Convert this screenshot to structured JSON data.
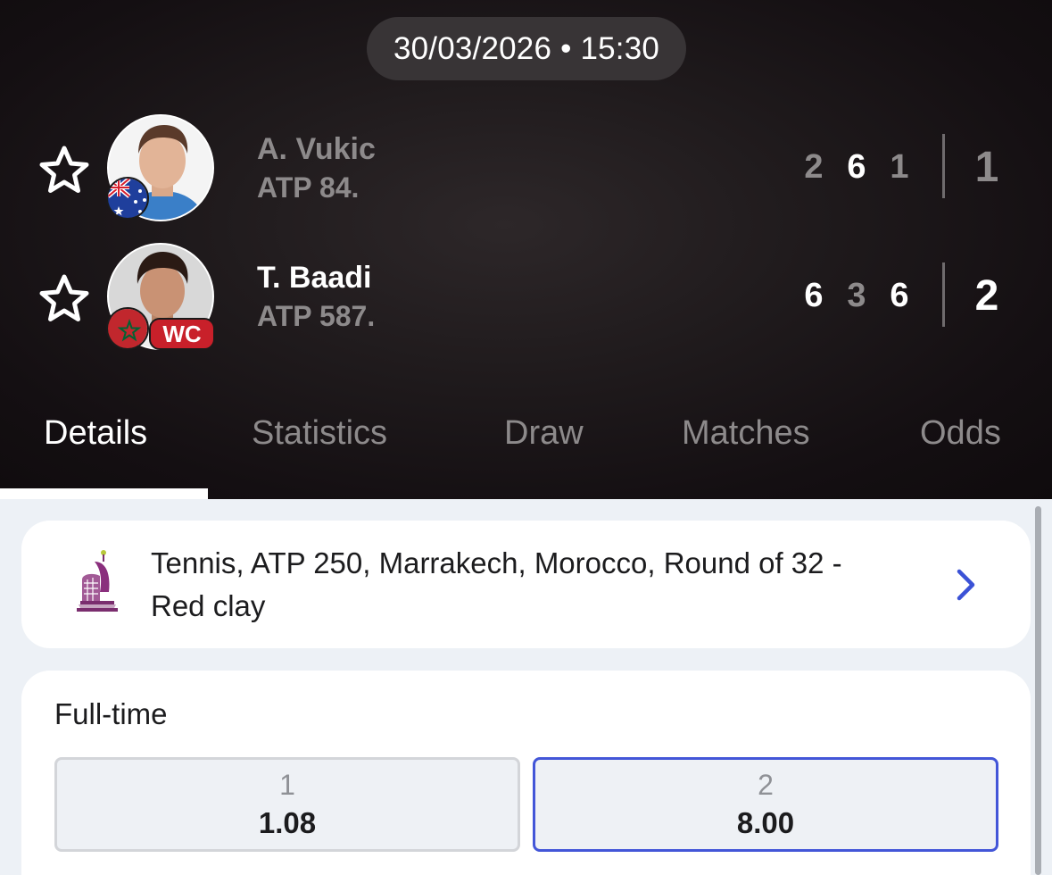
{
  "match": {
    "datetime": "30/03/2026 • 15:30"
  },
  "players": [
    {
      "name": "A. Vukic",
      "rank": "ATP 84.",
      "flag": "australia-flag",
      "sets": [
        "2",
        "6",
        "1"
      ],
      "total": "1"
    },
    {
      "name": "T. Baadi",
      "rank": "ATP 587.",
      "flag": "morocco-flag",
      "badge": "WC",
      "sets": [
        "6",
        "3",
        "6"
      ],
      "total": "2"
    }
  ],
  "tabs": [
    {
      "label": "Details",
      "active": true
    },
    {
      "label": "Statistics",
      "active": false
    },
    {
      "label": "Draw",
      "active": false
    },
    {
      "label": "Matches",
      "active": false
    },
    {
      "label": "Odds",
      "active": false
    }
  ],
  "league": {
    "line1": "Tennis, ATP 250, Marrakech, Morocco, Round of 32 -",
    "line2": "Red clay",
    "icon": "tournament-logo-icon"
  },
  "odds": {
    "title": "Full-time",
    "options": [
      {
        "label": "1",
        "value": "1.08",
        "selected": false
      },
      {
        "label": "2",
        "value": "8.00",
        "selected": true
      }
    ]
  },
  "colors": {
    "header_bg": "#1a1517",
    "content_bg": "#edf1f6",
    "accent_blue": "#4356d8",
    "wc_red": "#c8202a",
    "muted_text": "#8d8a8b"
  }
}
